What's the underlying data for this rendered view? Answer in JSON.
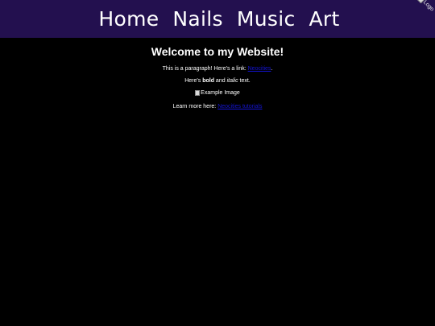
{
  "nav": {
    "items": [
      {
        "label": "Home"
      },
      {
        "label": "Nails"
      },
      {
        "label": "Music"
      },
      {
        "label": "Art"
      }
    ],
    "logo_alt": "Logo"
  },
  "main": {
    "heading": "Welcome to my Website!",
    "para1_text": "This is a paragraph! Here's a link: ",
    "para1_link": "Neocities",
    "para1_end": ".",
    "para2_start": "Here's ",
    "para2_bold": "bold",
    "para2_mid": " and ",
    "para2_italic": "italic",
    "para2_end": " text.",
    "image_alt": "Example Image",
    "para4_text": "Learn more here: ",
    "para4_link": "Neocities tutorials"
  },
  "colors": {
    "background": "#000000",
    "navbar": "#23104f",
    "text": "#ffffff",
    "link": "#1414d6"
  }
}
